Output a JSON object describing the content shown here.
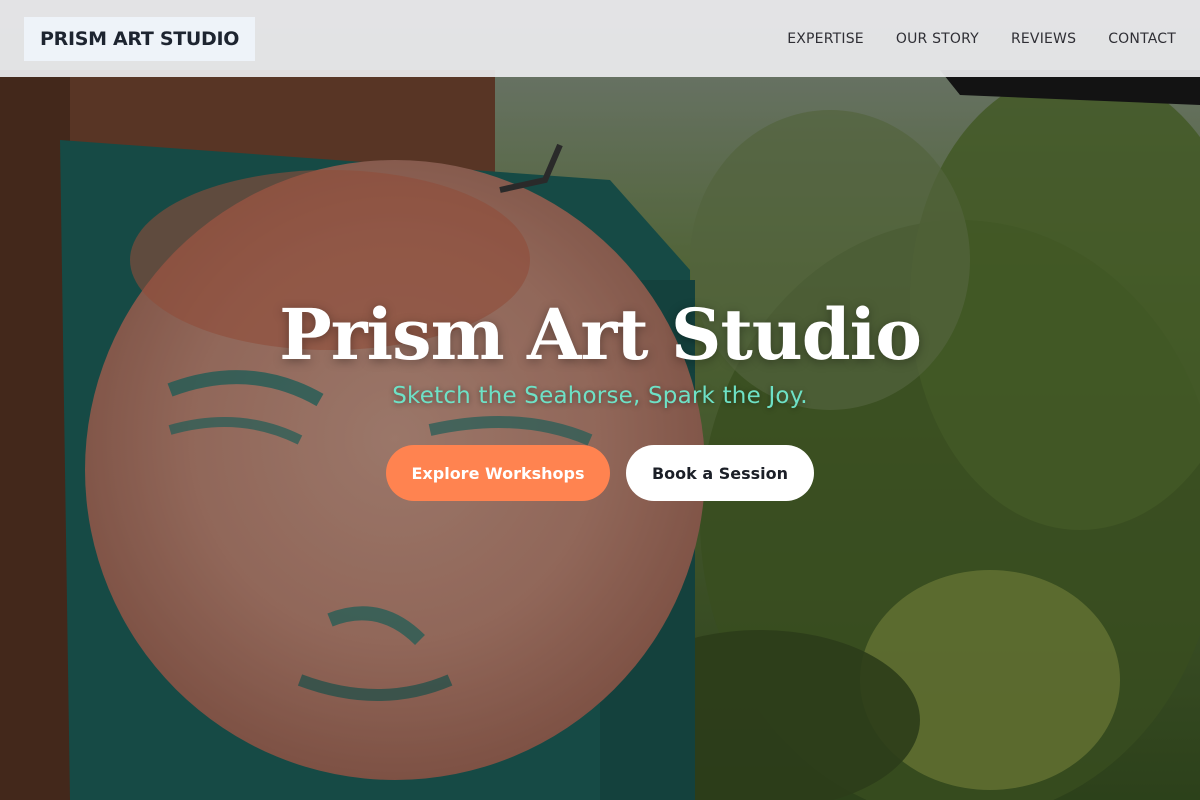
{
  "brand": {
    "logo_text": "PRISM ART STUDIO"
  },
  "nav": {
    "items": [
      {
        "label": "EXPERTISE"
      },
      {
        "label": "OUR STORY"
      },
      {
        "label": "REVIEWS"
      },
      {
        "label": "CONTACT"
      }
    ]
  },
  "hero": {
    "title": "Prism Art Studio",
    "tagline": "Sketch the Seahorse, Spark the Joy.",
    "primary_cta": "Explore Workshops",
    "secondary_cta": "Book a Session",
    "background_description_icon": "painted-face-artwork-image"
  },
  "colors": {
    "accent": "#ff8350",
    "tagline": "#6ee1c6",
    "nav_bg": "#ececee",
    "text_dark": "#1d2430"
  }
}
